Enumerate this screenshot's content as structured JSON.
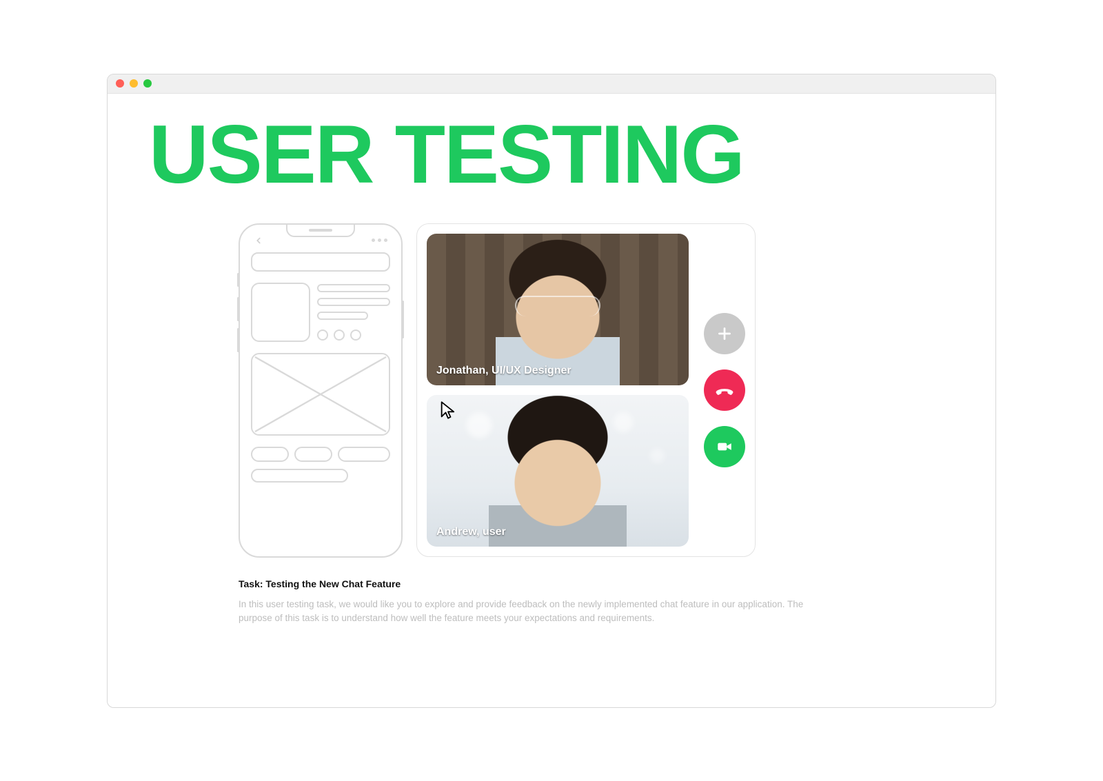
{
  "colors": {
    "accent_green": "#1ec95e",
    "hangup_red": "#ef2a55",
    "add_gray": "#c9c9c9"
  },
  "header": {
    "title": "USER TESTING"
  },
  "call": {
    "participants": [
      {
        "label": "Jonathan, UI/UX Designer"
      },
      {
        "label": "Andrew, user"
      }
    ],
    "buttons": {
      "add_icon": "plus-icon",
      "hangup_icon": "phone-hangup-icon",
      "video_icon": "video-camera-icon"
    }
  },
  "task": {
    "title": "Task: Testing the New Chat Feature",
    "body": "In this user testing task, we would like you to explore and provide feedback on the newly implemented chat feature in our application. The purpose of this task is to understand how well the feature meets your expectations and requirements."
  }
}
